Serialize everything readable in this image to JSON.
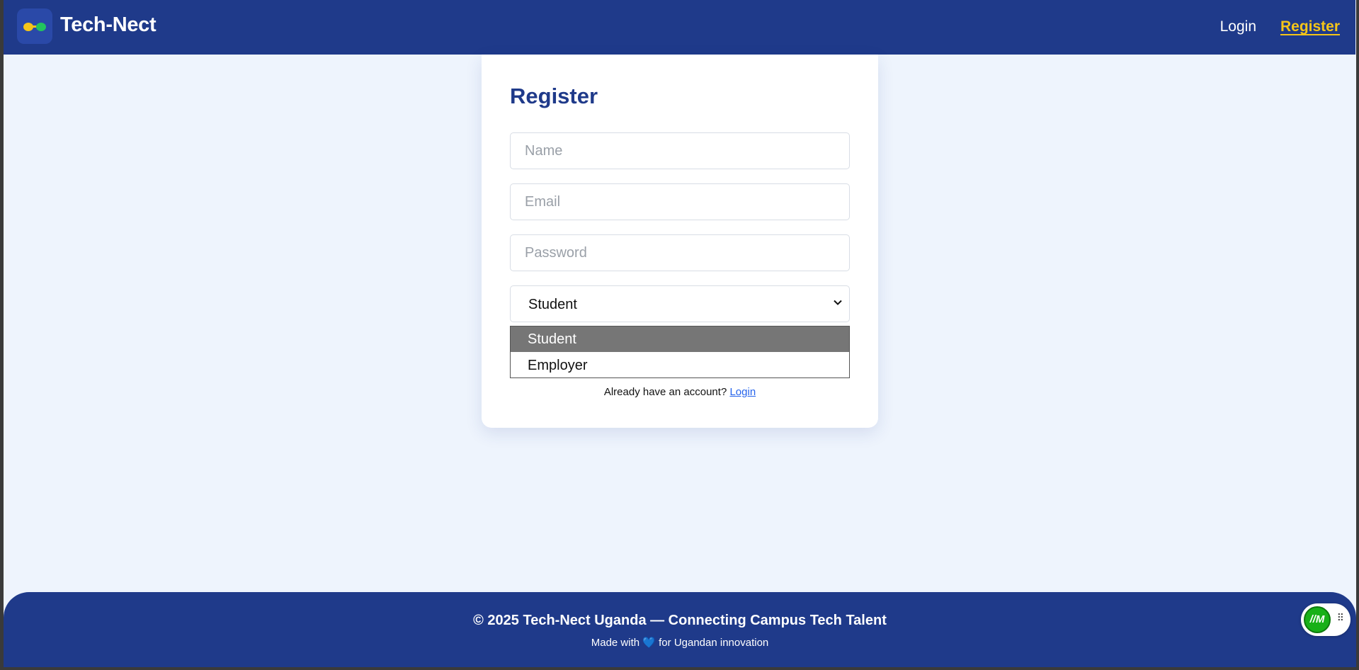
{
  "header": {
    "brand": "Tech-Nect",
    "nav": {
      "login": "Login",
      "register": "Register"
    },
    "colors": {
      "background": "#1f3a8a",
      "accent": "#f5c518"
    }
  },
  "form": {
    "title": "Register",
    "name_placeholder": "Name",
    "email_placeholder": "Email",
    "password_placeholder": "Password",
    "role": {
      "selected": "Student",
      "options": [
        "Student",
        "Employer"
      ]
    },
    "already_text": "Already have an account?",
    "login_link": "Login"
  },
  "footer": {
    "copyright": "© 2025 Tech-Nect Uganda — Connecting Campus Tech Talent",
    "made_with": "Made with",
    "heart": "💙",
    "made_for": "for Ugandan innovation"
  },
  "widget": {
    "label": "//M",
    "icon": "grip-icon"
  }
}
